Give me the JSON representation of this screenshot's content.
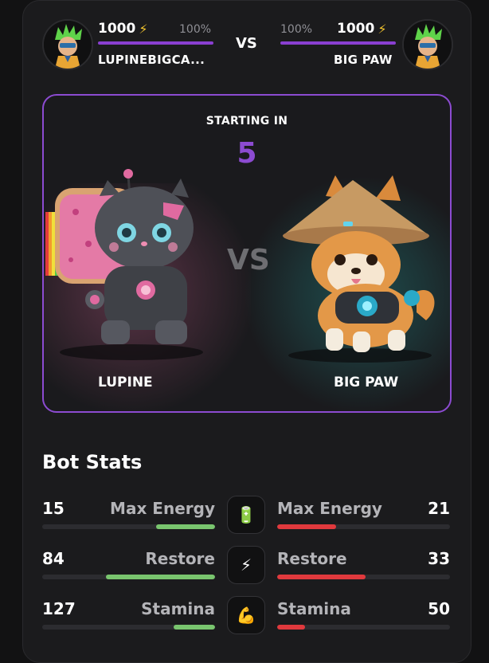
{
  "header": {
    "vs_label": "VS",
    "player_left": {
      "energy": "1000",
      "percent": "100%",
      "name": "LUPINEBIGCA..."
    },
    "player_right": {
      "energy": "1000",
      "percent": "100%",
      "name": "BIG PAW"
    },
    "energy_icon": "lightning-bolt-icon"
  },
  "arena": {
    "starting_label": "STARTING IN",
    "countdown": "5",
    "vs_label": "VS",
    "left_bot": "LUPINE",
    "right_bot": "BIG PAW"
  },
  "stats": {
    "title": "Bot Stats",
    "rows": [
      {
        "label": "Max Energy",
        "left_value": "15",
        "right_value": "21",
        "icon": "battery-icon",
        "left_fill": 0.34,
        "right_fill": 0.34
      },
      {
        "label": "Restore",
        "left_value": "84",
        "right_value": "33",
        "icon": "lightning-bolt-icon",
        "left_fill": 0.63,
        "right_fill": 0.51
      },
      {
        "label": "Stamina",
        "left_value": "127",
        "right_value": "50",
        "icon": "flexed-biceps-icon",
        "left_fill": 0.24,
        "right_fill": 0.16
      }
    ]
  },
  "colors": {
    "accent": "#8c4bd1",
    "good": "#79c56e",
    "bad": "#e0393d",
    "bolt": "#f4c52e"
  }
}
